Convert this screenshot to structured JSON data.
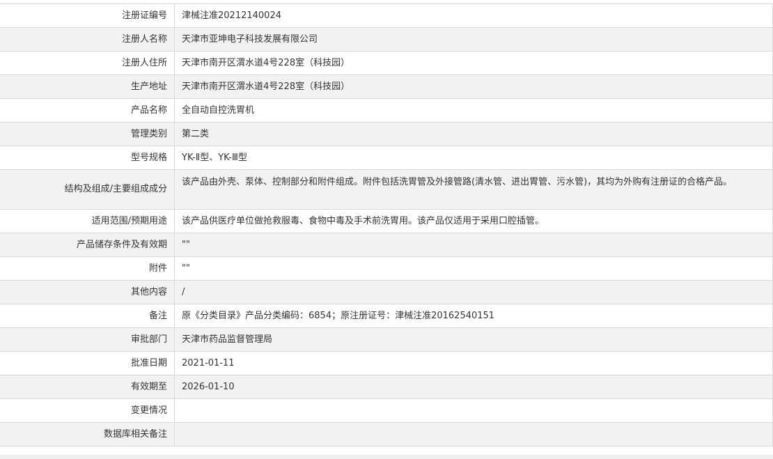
{
  "rows": [
    {
      "label": "注册证编号",
      "value": "津械注准20212140024"
    },
    {
      "label": "注册人名称",
      "value": "天津市亚坤电子科技发展有限公司"
    },
    {
      "label": "注册人住所",
      "value": "天津市南开区渭水道4号228室（科技园）"
    },
    {
      "label": "生产地址",
      "value": "天津市南开区渭水道4号228室（科技园）"
    },
    {
      "label": "产品名称",
      "value": "全自动自控洗胃机"
    },
    {
      "label": "管理类别",
      "value": "第二类"
    },
    {
      "label": "型号规格",
      "value": "YK-Ⅱ型、YK-Ⅲ型"
    },
    {
      "label": "结构及组成/主要组成成分",
      "value": "该产品由外壳、泵体、控制部分和附件组成。附件包括洗胃管及外接管路(清水管、进出胃管、污水管)，其均为外购有注册证的合格产品。"
    },
    {
      "label": "适用范围/预期用途",
      "value": "该产品供医疗单位做抢救服毒、食物中毒及手术前洗胃用。该产品仅适用于采用口腔插管。"
    },
    {
      "label": "产品储存条件及有效期",
      "value": "\"\""
    },
    {
      "label": "附件",
      "value": "\"\""
    },
    {
      "label": "其他内容",
      "value": "/"
    },
    {
      "label": "备注",
      "value": "原《分类目录》产品分类编码：6854；原注册证号：津械注准20162540151"
    },
    {
      "label": "审批部门",
      "value": "天津市药品监督管理局"
    },
    {
      "label": "批准日期",
      "value": "2021-01-11"
    },
    {
      "label": "有效期至",
      "value": "2026-01-10"
    },
    {
      "label": "变更情况",
      "value": ""
    },
    {
      "label": "数据库相关备注",
      "value": ""
    }
  ]
}
